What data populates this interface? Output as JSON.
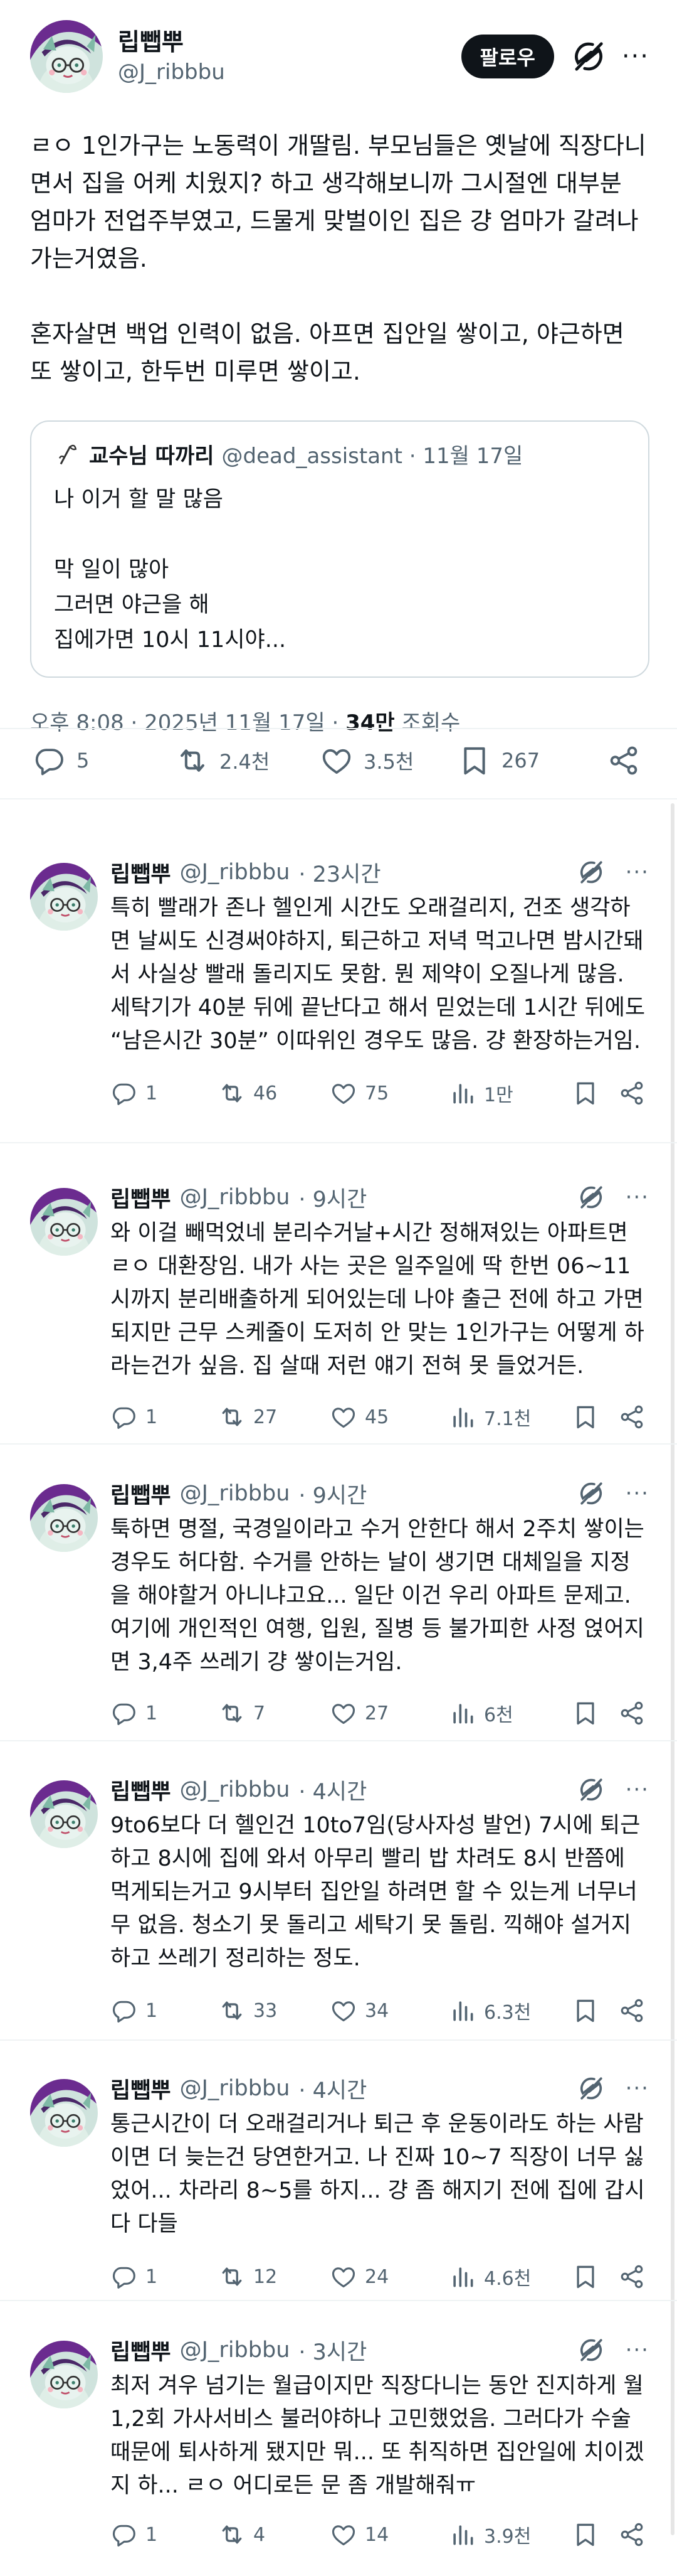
{
  "author": {
    "name": "립뺍뿌",
    "handle": "@J_ribbbu"
  },
  "header": {
    "follow_label": "팔로우",
    "more_label": "···"
  },
  "post": {
    "text": "ㄹㅇ 1인가구는 노동력이 개딸림. 부모님들은 옛날에 직장다니면서 집을 어케 치웠지? 하고 생각해보니까 그시절엔 대부분 엄마가 전업주부였고, 드물게 맞벌이인 집은 걍 엄마가 갈려나가는거였음.\n\n혼자살면 백업 인력이 없음. 아프면 집안일 쌓이고, 야근하면 또 쌓이고, 한두번 미루면 쌓이고.",
    "quote": {
      "name": "교수님 따까리",
      "meta": "@dead_assistant · 11월 17일",
      "text": "나 이거 할 말 많음\n\n막 일이 많아\n그러면 야근을 해\n집에가면 10시 11시야..."
    },
    "timestamp_prefix": "오후 8:08 · 2025년 11월 17일 · ",
    "views_value": "34만",
    "views_suffix": " 조회수",
    "stats": {
      "replies": "5",
      "reposts": "2.4천",
      "likes": "3.5천",
      "bookmarks": "267"
    }
  },
  "replies": [
    {
      "time": "· 23시간",
      "text": "특히 빨래가 존나 헬인게 시간도 오래걸리지, 건조 생각하면 날씨도 신경써야하지, 퇴근하고 저녁 먹고나면 밤시간돼서 사실상 빨래 돌리지도 못함. 뭔 제약이 오질나게 많음. 세탁기가 40분 뒤에 끝난다고 해서 믿었는데 1시간 뒤에도 “남은시간 30분” 이따위인 경우도 많음. 걍 환장하는거임.",
      "replies": "1",
      "reposts": "46",
      "likes": "75",
      "views": "1만"
    },
    {
      "time": "· 9시간",
      "text": "와 이걸 빼먹었네 분리수거날+시간 정해져있는 아파트면 ㄹㅇ 대환장임. 내가 사는 곳은 일주일에 딱 한번 06~11시까지 분리배출하게 되어있는데 나야 출근 전에 하고 가면 되지만 근무 스케줄이 도저히 안 맞는 1인가구는 어떻게 하라는건가 싶음. 집 살때 저런 얘기 전혀 못 들었거든.",
      "replies": "1",
      "reposts": "27",
      "likes": "45",
      "views": "7.1천"
    },
    {
      "time": "· 9시간",
      "text": "툭하면 명절, 국경일이라고 수거 안한다 해서 2주치 쌓이는 경우도 허다함. 수거를 안하는 날이 생기면 대체일을 지정을 해야할거 아니냐고요... 일단 이건 우리 아파트 문제고. 여기에 개인적인 여행, 입원, 질병 등 불가피한 사정 얹어지면 3,4주 쓰레기 걍 쌓이는거임.",
      "replies": "1",
      "reposts": "7",
      "likes": "27",
      "views": "6천"
    },
    {
      "time": "· 4시간",
      "text": "9to6보다 더 헬인건 10to7임(당사자성 발언) 7시에 퇴근하고 8시에 집에 와서 아무리 빨리 밥 차려도 8시 반쯤에 먹게되는거고 9시부터 집안일 하려면 할 수 있는게 너무너무 없음. 청소기 못 돌리고 세탁기 못 돌림. 끽해야 설거지하고 쓰레기 정리하는 정도.",
      "replies": "1",
      "reposts": "33",
      "likes": "34",
      "views": "6.3천"
    },
    {
      "time": "· 4시간",
      "text": "통근시간이 더 오래걸리거나 퇴근 후 운동이라도 하는 사람이면 더 늦는건 당연한거고. 나 진짜 10~7 직장이 너무 싫었어... 차라리 8~5를 하지... 걍 좀 해지기 전에 집에 갑시다 다들",
      "replies": "1",
      "reposts": "12",
      "likes": "24",
      "views": "4.6천"
    },
    {
      "time": "· 3시간",
      "text": "최저 겨우 넘기는 월급이지만 직장다니는 동안 진지하게 월 1,2회 가사서비스 불러야하나 고민했었음. 그러다가 수술때문에 퇴사하게 됐지만 뭐... 또 취직하면 집안일에 치이겠지 하... ㄹㅇ 어디로든 문 좀 개발해줘ㅠ",
      "replies": "1",
      "reposts": "4",
      "likes": "14",
      "views": "3.9천"
    }
  ]
}
